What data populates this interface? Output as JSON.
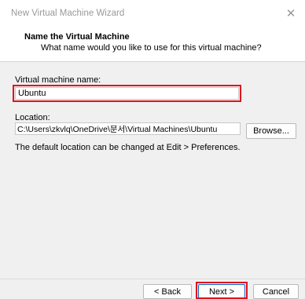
{
  "window": {
    "title": "New Virtual Machine Wizard",
    "close_glyph": "✕"
  },
  "header": {
    "title": "Name the Virtual Machine",
    "subtitle": "What name would you like to use for this virtual machine?"
  },
  "form": {
    "vm_name_label": "Virtual machine name:",
    "vm_name_value": "Ubuntu",
    "location_label": "Location:",
    "location_value": "C:\\Users\\zkvlq\\OneDrive\\문서\\Virtual Machines\\Ubuntu",
    "browse_label": "Browse...",
    "default_location_note": "The default location can be changed at Edit > Preferences."
  },
  "buttons": {
    "back_label": "< Back",
    "next_label": "Next >",
    "cancel_label": "Cancel"
  },
  "colors": {
    "highlight": "#e0141e",
    "primary_border": "#0a64c8",
    "title_text": "#9a9a9a"
  }
}
